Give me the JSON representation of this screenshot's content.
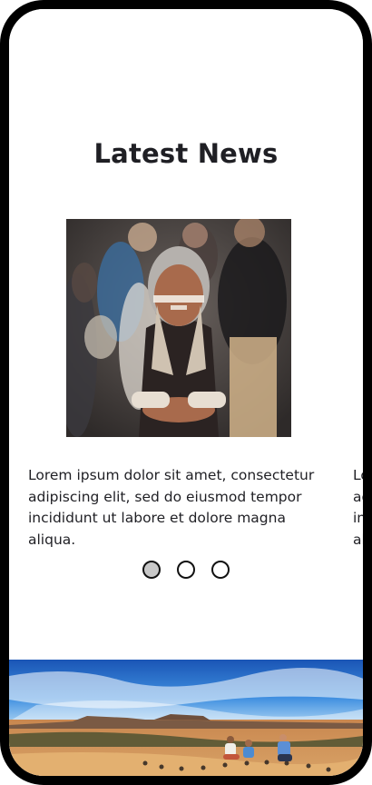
{
  "page": {
    "title": "Latest News"
  },
  "news": {
    "cards": [
      {
        "text": "Lorem ipsum dolor sit amet, consectetur adipiscing elit, sed do eiusmod tempor incididunt ut labore et dolore magna aliqua.",
        "image_icon": "photo-child-in-ceremonial-paint-icon"
      },
      {
        "text": "Lorem ipsum dolor sit amet, consectetur adipiscing elit, sed do eiusmod tempor incididunt ut labore et dolore magna aliqua."
      }
    ]
  },
  "carousel": {
    "dots": [
      {
        "state": "active"
      },
      {
        "state": "inactive"
      },
      {
        "state": "inactive"
      }
    ]
  },
  "colors": {
    "text": "#1f1f24",
    "frame": "#000000",
    "dot_active": "#c8c8c8"
  }
}
